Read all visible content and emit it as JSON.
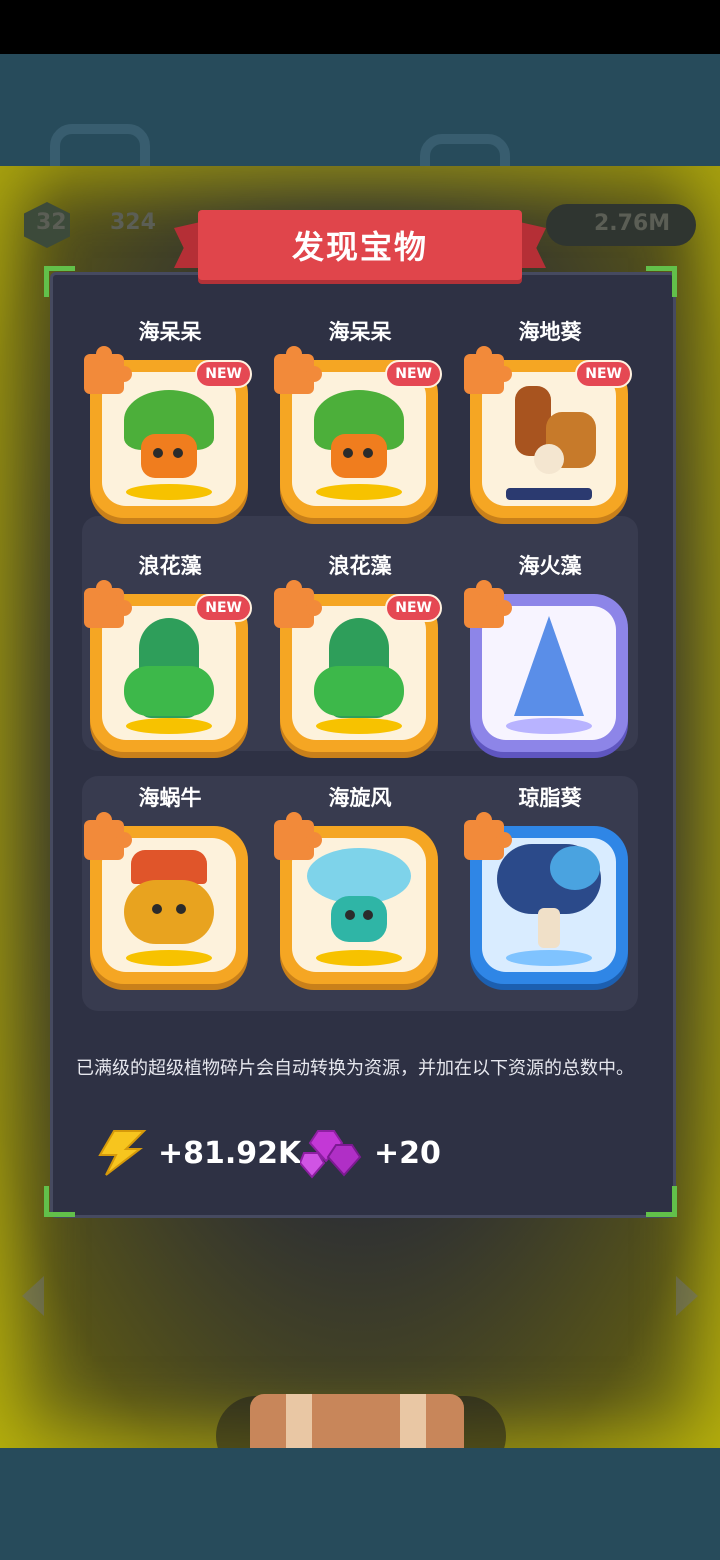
{
  "dialog": {
    "title": "发现宝物"
  },
  "hud": {
    "level": "32",
    "score": "324",
    "energy": "2.76M"
  },
  "cards": [
    {
      "name": "海呆呆",
      "badge": "NEW",
      "style": "gold"
    },
    {
      "name": "海呆呆",
      "badge": "NEW",
      "style": "gold"
    },
    {
      "name": "海地葵",
      "badge": "NEW",
      "style": "gold"
    },
    {
      "name": "浪花藻",
      "badge": "NEW",
      "style": "gold"
    },
    {
      "name": "浪花藻",
      "badge": "NEW",
      "style": "gold"
    },
    {
      "name": "海火藻",
      "badge": "",
      "style": "purple"
    },
    {
      "name": "海蜗牛",
      "badge": "",
      "style": "gold"
    },
    {
      "name": "海旋风",
      "badge": "",
      "style": "gold"
    },
    {
      "name": "琼脂葵",
      "badge": "",
      "style": "blue"
    }
  ],
  "info": {
    "text": "已满级的超级植物碎片会自动转换为资源，并加在以下资源的总数中。"
  },
  "rewards": [
    {
      "icon": "lightning-icon",
      "amount": "+81.92K"
    },
    {
      "icon": "gem-icon",
      "amount": "+20"
    }
  ],
  "colors": {
    "ribbon": "#e0454b",
    "panel": "#2e3144",
    "card_gold": "#f5a623",
    "card_purple": "#8d85e8",
    "card_blue": "#2f86e6",
    "new_badge": "#e54853"
  }
}
